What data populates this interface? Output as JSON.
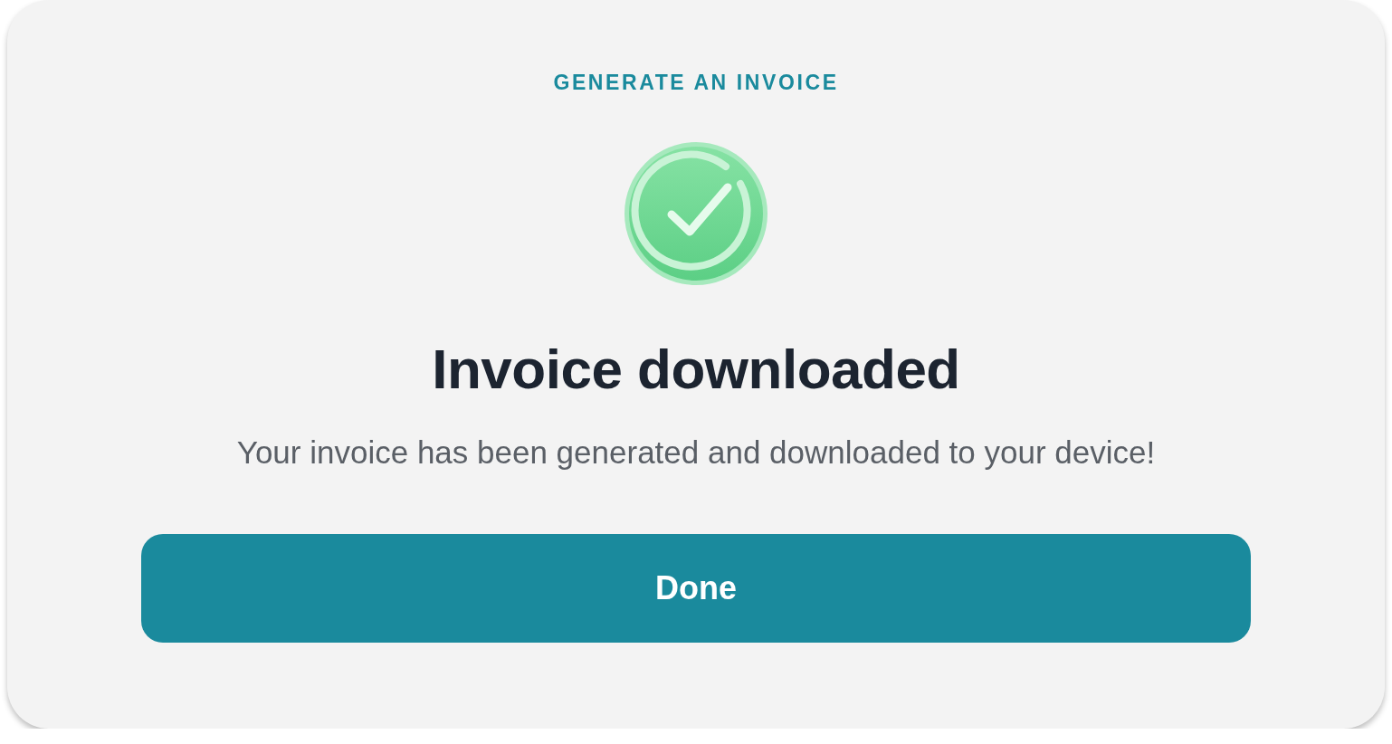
{
  "eyebrow": "GENERATE AN INVOICE",
  "title": "Invoice downloaded",
  "message": "Your invoice has been generated and downloaded to your device!",
  "button": {
    "label": "Done"
  }
}
